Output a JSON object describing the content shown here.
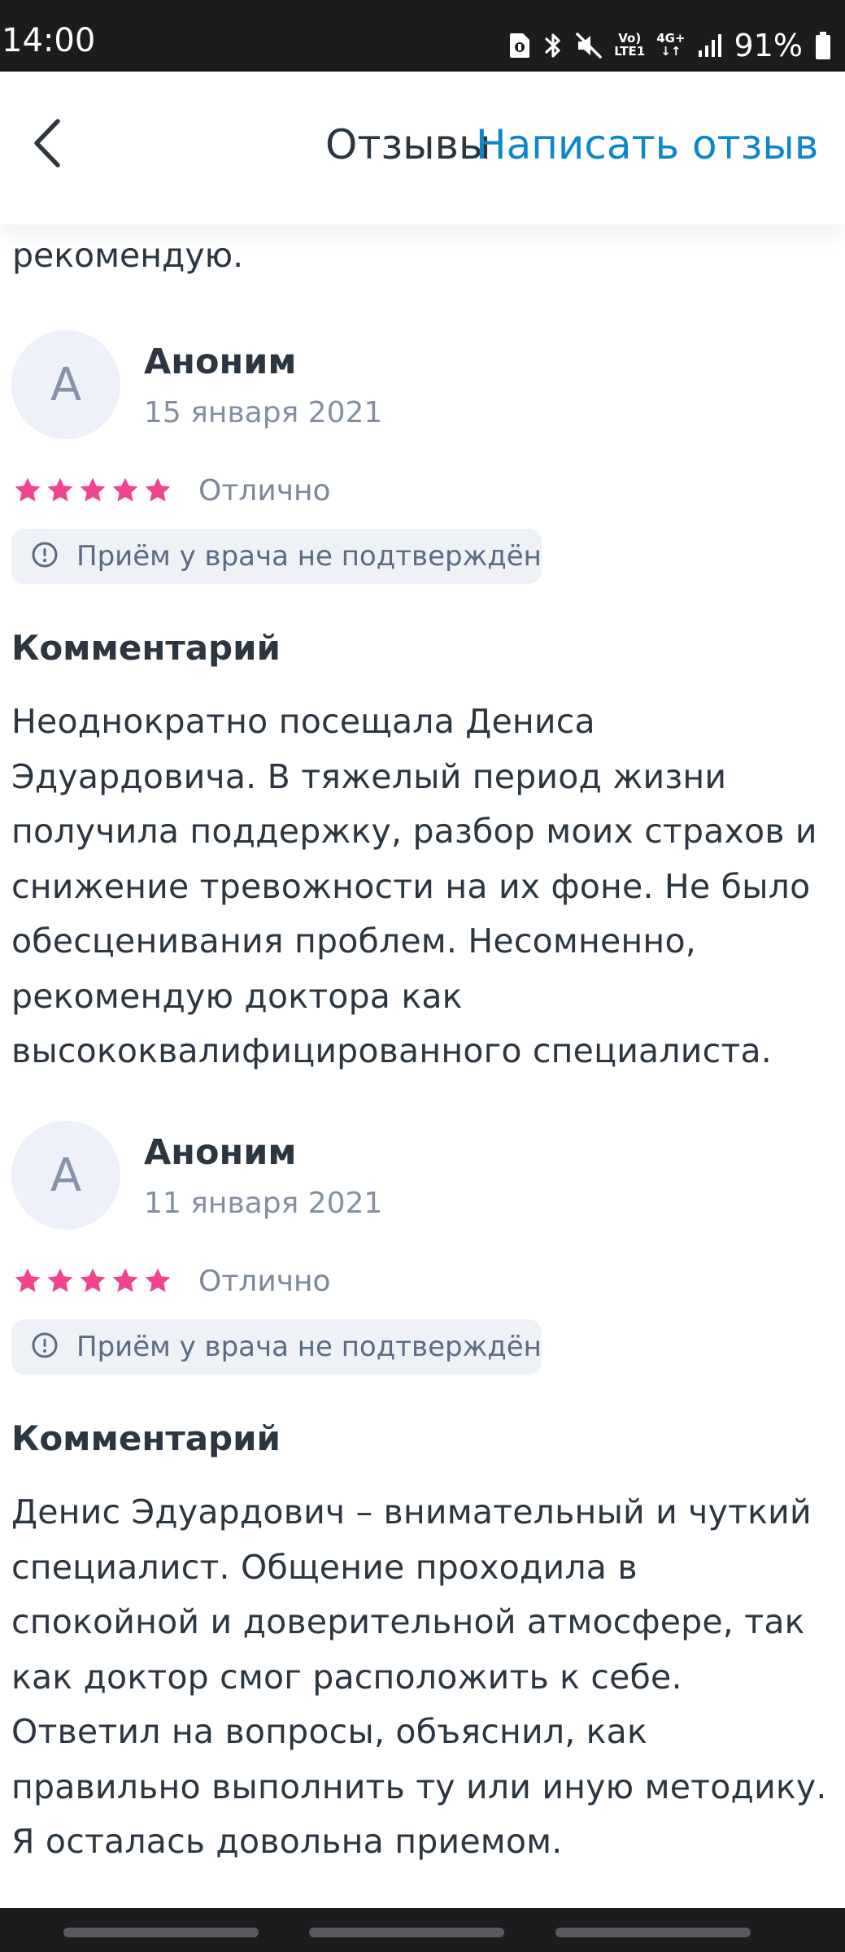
{
  "status_bar": {
    "time": "14:00",
    "network_top": "Vo)",
    "network_bottom": "LTE1",
    "network_type": "4G+",
    "battery": "91%",
    "icons": [
      "sim-icon",
      "bluetooth-icon",
      "mute-icon",
      "signal-icon",
      "battery-icon"
    ]
  },
  "header": {
    "back_icon": "chevron-left-icon",
    "title": "Отзывы",
    "write_review": "Написать отзыв"
  },
  "cut_off_text": "рекомендую.",
  "reviews": [
    {
      "avatar_letter": "А",
      "author": "Аноним",
      "date": "15 января 2021",
      "stars": 5,
      "rating_label": "Отлично",
      "badge_icon": "info-icon",
      "badge_text": "Приём у врача не подтверждён",
      "comment_heading": "Комментарий",
      "comment": "Неоднократно посещала Дениса Эдуардовича. В тяжелый период жизни получила поддержку, разбор моих страхов и снижение тревожности на их фоне. Не было обесценивания проблем. Несомненно, рекомендую доктора как высококвалифицированного специалиста."
    },
    {
      "avatar_letter": "А",
      "author": "Аноним",
      "date": "11 января 2021",
      "stars": 5,
      "rating_label": "Отлично",
      "badge_icon": "info-icon",
      "badge_text": "Приём у врача не подтверждён",
      "comment_heading": "Комментарий",
      "comment": "Денис Эдуардович – внимательный и чуткий специалист. Общение проходила в спокойной и доверительной атмосфере, так как доктор смог расположить к себе. Ответил на вопросы, объяснил, как правильно выполнить ту или иную методику. Я осталась довольна приемом."
    }
  ],
  "colors": {
    "accent": "#0e87ca",
    "star": "#f0448c",
    "text": "#2c3640",
    "muted": "#8390a3",
    "badge_bg": "#eef2f7",
    "avatar_bg": "#eef1f9"
  }
}
